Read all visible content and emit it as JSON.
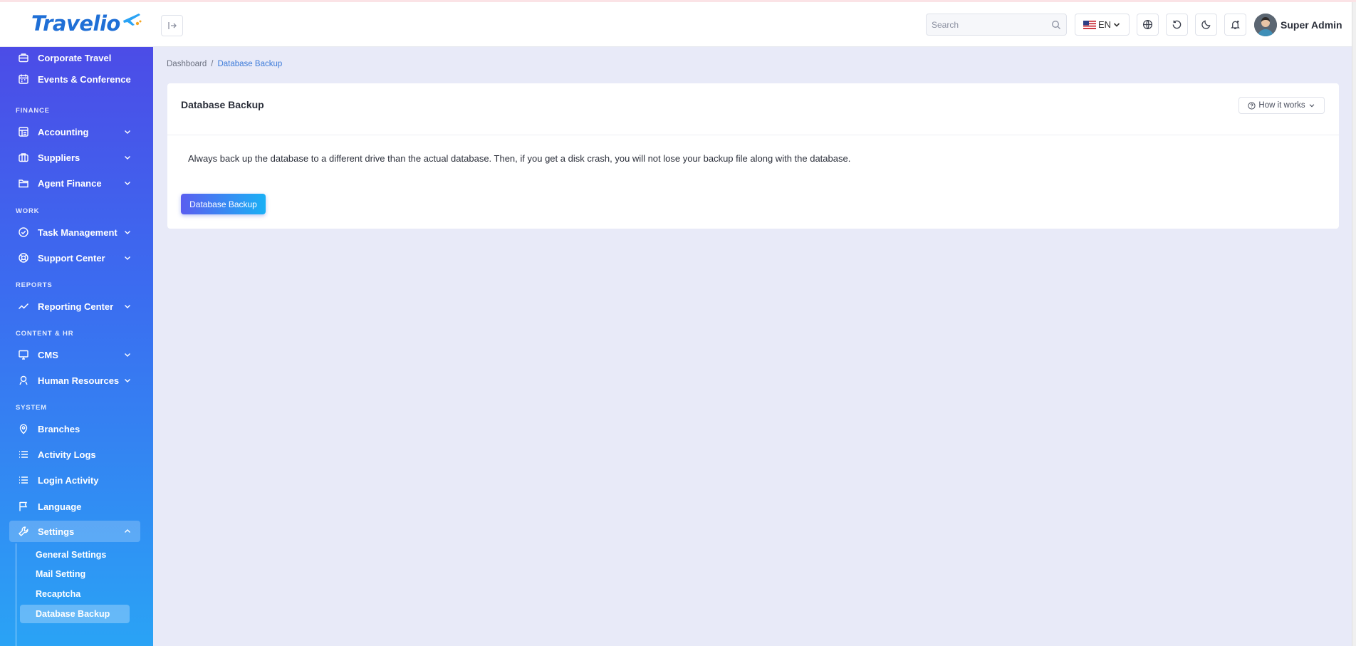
{
  "app": {
    "logo_text": "Travelio",
    "user_name": "Super Admin"
  },
  "header": {
    "search_placeholder": "Search",
    "language": "EN"
  },
  "sidebar": {
    "items_top": [
      {
        "label": "Corporate Travel",
        "icon": "briefcase-icon"
      },
      {
        "label": "Events & Conference",
        "icon": "calendar-icon"
      }
    ],
    "sections": [
      {
        "label": "FINANCE"
      },
      {
        "label": "WORK"
      },
      {
        "label": "REPORTS"
      },
      {
        "label": "CONTENT & HR"
      },
      {
        "label": "SYSTEM"
      }
    ],
    "items": {
      "accounting": "Accounting",
      "suppliers": "Suppliers",
      "agent_finance": "Agent Finance",
      "task_management": "Task Management",
      "support_center": "Support Center",
      "reporting_center": "Reporting Center",
      "cms": "CMS",
      "human_resources": "Human Resources",
      "branches": "Branches",
      "activity_logs": "Activity Logs",
      "login_activity": "Login Activity",
      "language": "Language",
      "settings": "Settings"
    },
    "settings_sub": [
      {
        "label": "General Settings"
      },
      {
        "label": "Mail Setting"
      },
      {
        "label": "Recaptcha"
      },
      {
        "label": "Database Backup"
      }
    ]
  },
  "breadcrumb": {
    "root": "Dashboard",
    "separator": "/",
    "current": "Database Backup"
  },
  "card": {
    "title": "Database Backup",
    "how_it_works": "How it works",
    "description": "Always back up the database to a different drive than the actual database. Then, if you get a disk crash, you will not lose your backup file along with the database.",
    "button_label": "Database Backup"
  },
  "colors": {
    "sidebar_top": "#4f46e5",
    "sidebar_bottom": "#2aa3f5",
    "accent": "#3d7bd9"
  }
}
